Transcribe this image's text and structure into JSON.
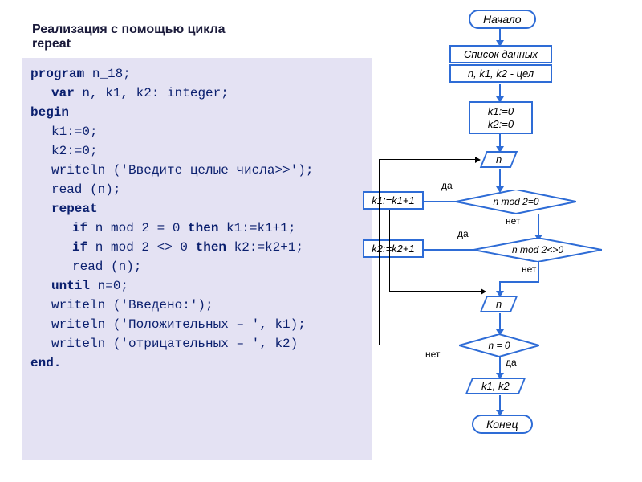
{
  "title": "Реализация с помощью цикла repeat",
  "code": {
    "l1a": "program",
    "l1b": " n_18;",
    "l2a": "var",
    "l2b": " n, k1, k2: integer;",
    "l3": "begin",
    "l4": "k1:=0;",
    "l5": "k2:=0;",
    "l6": "writeln ('Введите целые числа>>');",
    "l7": "read (n);",
    "l8": "repeat",
    "l9a": "if",
    "l9b": " n mod 2 = 0 ",
    "l9c": "then",
    "l9d": " k1:=k1+1;",
    "l10a": "if",
    "l10b": " n mod 2 <> 0 ",
    "l10c": "then",
    "l10d": " k2:=k2+1;",
    "l11": "read (n);",
    "l12a": "until",
    "l12b": " n=0;",
    "l13": "writeln ('Введено:');",
    "l14": "writeln ('Положительных – ', k1);",
    "l15": "writeln ('отрицательных – ', k2)",
    "l16": "end."
  },
  "flow": {
    "start": "Начало",
    "datalist": "Список данных",
    "decl": "n, k1, k2 - цел",
    "init1": "k1:=0",
    "init2": "k2:=0",
    "input_n": "n",
    "cond1": "n mod 2=0",
    "act1": "k1:=k1+1",
    "cond2": "n mod 2<>0",
    "act2": "k2:=k2+1",
    "input_n2": "n",
    "cond3": "n = 0",
    "output": "k1, k2",
    "end": "Конец",
    "yes": "да",
    "no": "нет"
  },
  "chart_data": {
    "type": "flowchart",
    "nodes": [
      {
        "id": "start",
        "shape": "terminator",
        "text": "Начало"
      },
      {
        "id": "data",
        "shape": "rect",
        "text": "Список данных"
      },
      {
        "id": "decl",
        "shape": "rect",
        "text": "n, k1, k2 - цел"
      },
      {
        "id": "init",
        "shape": "rect",
        "text": "k1:=0; k2:=0"
      },
      {
        "id": "in1",
        "shape": "parallelogram",
        "text": "n"
      },
      {
        "id": "d1",
        "shape": "decision",
        "text": "n mod 2=0"
      },
      {
        "id": "a1",
        "shape": "rect",
        "text": "k1:=k1+1"
      },
      {
        "id": "d2",
        "shape": "decision",
        "text": "n mod 2<>0"
      },
      {
        "id": "a2",
        "shape": "rect",
        "text": "k2:=k2+1"
      },
      {
        "id": "in2",
        "shape": "parallelogram",
        "text": "n"
      },
      {
        "id": "d3",
        "shape": "decision",
        "text": "n = 0"
      },
      {
        "id": "out",
        "shape": "parallelogram",
        "text": "k1, k2"
      },
      {
        "id": "end",
        "shape": "terminator",
        "text": "Конец"
      }
    ],
    "edges": [
      {
        "from": "start",
        "to": "data"
      },
      {
        "from": "data",
        "to": "decl"
      },
      {
        "from": "decl",
        "to": "init"
      },
      {
        "from": "init",
        "to": "in1"
      },
      {
        "from": "in1",
        "to": "d1"
      },
      {
        "from": "d1",
        "to": "a1",
        "label": "да"
      },
      {
        "from": "d1",
        "to": "d2",
        "label": "нет"
      },
      {
        "from": "a1",
        "to": "d2"
      },
      {
        "from": "d2",
        "to": "a2",
        "label": "да"
      },
      {
        "from": "d2",
        "to": "in2",
        "label": "нет"
      },
      {
        "from": "a2",
        "to": "in2"
      },
      {
        "from": "in2",
        "to": "d3"
      },
      {
        "from": "d3",
        "to": "in1",
        "label": "нет"
      },
      {
        "from": "d3",
        "to": "out",
        "label": "да"
      },
      {
        "from": "out",
        "to": "end"
      }
    ]
  }
}
